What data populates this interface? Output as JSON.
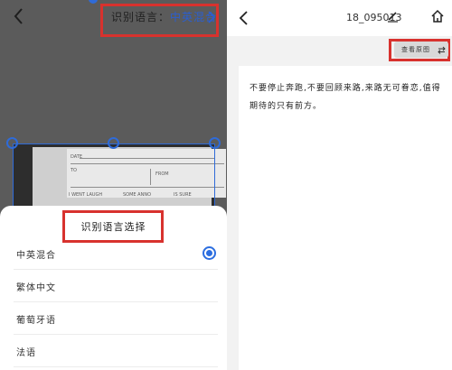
{
  "left": {
    "recognition_language": {
      "label": "识别语言：",
      "value": "中英混合"
    },
    "photo_text": {
      "date": "DATE",
      "to": "TO",
      "from": "FROM",
      "options": [
        "I WENT LAUGH",
        "SOME ANNO",
        "IS SURE"
      ]
    },
    "sheet": {
      "title": "识别语言选择",
      "options": [
        {
          "label": "中英混合",
          "selected": true
        },
        {
          "label": "繁体中文",
          "selected": false
        },
        {
          "label": "葡萄牙语",
          "selected": false
        },
        {
          "label": "法语",
          "selected": false
        }
      ]
    }
  },
  "right": {
    "file_name": "18_095013",
    "view_original": "查看原图",
    "document_text": "不要停止奔跑,不要回顾来路,来路无可眷恋,值得期待的只有前方。"
  },
  "colors": {
    "accent_blue": "#2c6ee0",
    "highlight_red": "#d8322e"
  }
}
